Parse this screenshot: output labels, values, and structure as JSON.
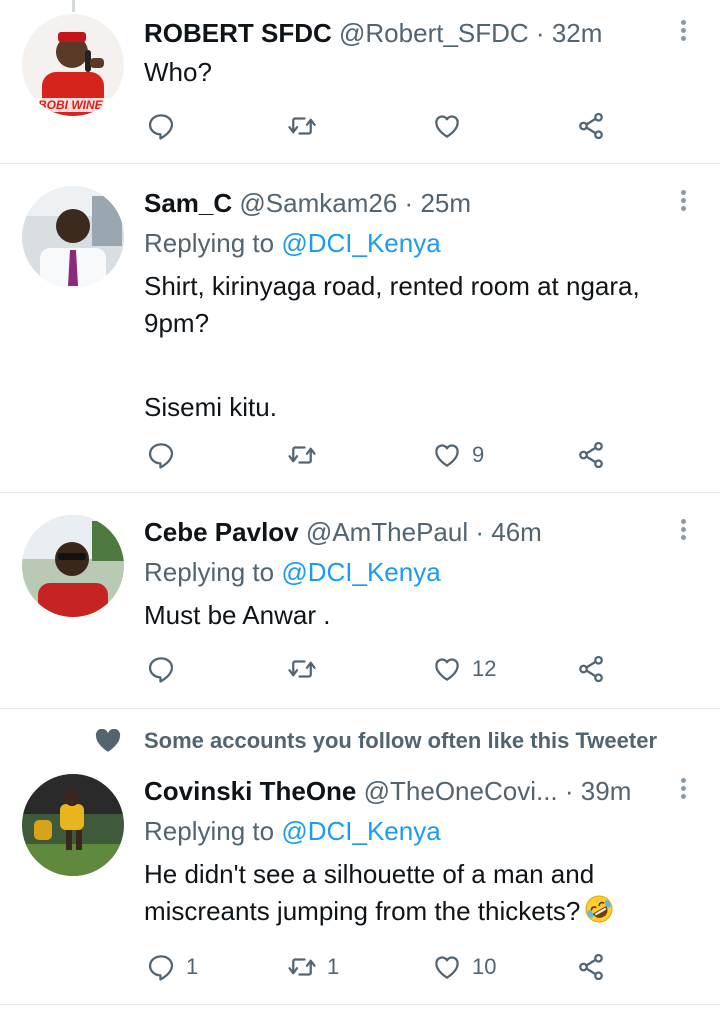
{
  "tweets": [
    {
      "name": "ROBERT SFDC",
      "handle": "@Robert_SFDC",
      "separator": "·",
      "time": "32m",
      "replying_prefix": "",
      "replying_to": "",
      "text": "Who?",
      "avatar_icon": "profile-photo-red-shirt-microphone",
      "avatar_caption": "BOBI WINE",
      "actions": {
        "reply": "",
        "retweet": "",
        "like": "",
        "share": ""
      }
    },
    {
      "name": "Sam_C",
      "handle": "@Samkam26",
      "separator": "·",
      "time": "25m",
      "replying_prefix": "Replying to",
      "replying_to": "@DCI_Kenya",
      "text_lines": [
        "Shirt, kirinyaga road, rented room at ngara,",
        "9pm?",
        "",
        "Sisemi kitu."
      ],
      "avatar_icon": "profile-photo-man-in-car",
      "actions": {
        "reply": "",
        "retweet": "",
        "like": "9",
        "share": ""
      }
    },
    {
      "name": "Cebe Pavlov",
      "handle": "@AmThePaul",
      "separator": "·",
      "time": "46m",
      "replying_prefix": "Replying to",
      "replying_to": "@DCI_Kenya",
      "text": "Must be Anwar .",
      "avatar_icon": "profile-photo-man-sunglasses",
      "actions": {
        "reply": "",
        "retweet": "",
        "like": "12",
        "share": ""
      }
    },
    {
      "social_context": "Some accounts you follow often like this Tweeter",
      "name": "Covinski TheOne",
      "handle": "@TheOneCovi...",
      "separator": "·",
      "time": "39m",
      "replying_prefix": "Replying to",
      "replying_to": "@DCI_Kenya",
      "text_lines": [
        "He didn't see a silhouette of a man and",
        "miscreants jumping from the thickets?"
      ],
      "emoji": "rolling-on-floor-laughing-emoji",
      "avatar_icon": "profile-photo-football-players",
      "actions": {
        "reply": "1",
        "retweet": "1",
        "like": "10",
        "share": ""
      }
    }
  ],
  "colors": {
    "text": "#0f1419",
    "secondary": "#536471",
    "link": "#1d9bf0",
    "divider": "#e4e7ea"
  }
}
